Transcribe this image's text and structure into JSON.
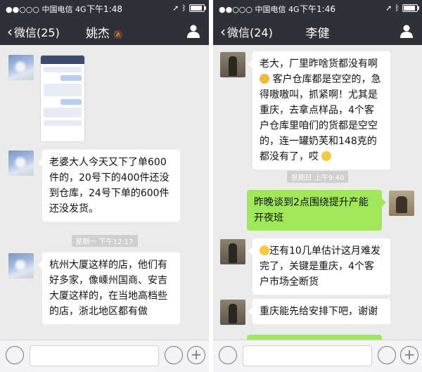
{
  "colors": {
    "nav_bg": "#2f3136",
    "chat_bg": "#ebebeb",
    "bubble_white": "#ffffff",
    "bubble_green": "#a0e75a",
    "stamp_bg": "#cfcfcf"
  },
  "left": {
    "status": {
      "carrier": "●●○○○ 中国电信 4G",
      "time": "下午1:48"
    },
    "nav": {
      "back_label": "微信(25)",
      "title": "姚杰"
    },
    "messages": [
      {
        "text": "老婆大人今天又下了单600件的，20号下的400件还没到仓库，24号下单的600件还没发货。"
      },
      {
        "text": "杭州大厦这样的店，他们有好多家，像嵊州国商、安吉大厦这样的，在当地高档些的店，浙北地区都有做"
      }
    ],
    "stamp": "星期一 下午12:17"
  },
  "right": {
    "status": {
      "carrier": "●●○○○ 中国电信 4G",
      "time": "下午1:46"
    },
    "nav": {
      "back_label": "微信(24)",
      "title": "李健"
    },
    "messages": [
      {
        "pre": "老大，厂里昨啥货都没有啊",
        "post": " 客户仓库都是空空的，急得嗷嗷叫，抓紧啊！尤其是重庆，去拿点样品，4个客户仓库里咱们的货都是空空的，连一罐奶芙和148克的都没有了，哎"
      },
      {
        "text": "昨晚谈到2点围绕提升产能开夜班"
      },
      {
        "text": "还有10几单估计这月难发完了，关键是重庆，4个客户市场全断货"
      },
      {
        "text": "重庆能先给安排下吧，谢谢"
      }
    ],
    "stamp": "星期日 上午9:40"
  }
}
